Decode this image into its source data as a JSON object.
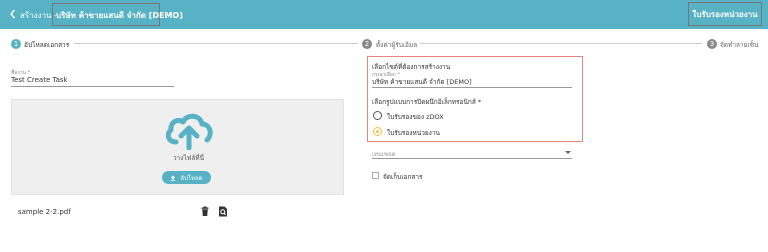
{
  "header": {
    "title": "สร้างงาน - ",
    "company": "บริษัท ค้าขายแสนดี จำกัด [DEMO]",
    "action_label": "ใบรับรองหน่วยงาน",
    "background": "#56b2c4"
  },
  "stepper": {
    "steps": [
      {
        "number": "1",
        "label": "อัปโหลดเอกสาร"
      },
      {
        "number": "2",
        "label": "ตั้งค่าผู้รับเอิมล"
      },
      {
        "number": "3",
        "label": "จัดทำลายเซ็น"
      }
    ]
  },
  "task": {
    "label": "ชื่องาน *",
    "value": "Test Create Task"
  },
  "upload": {
    "drop_text": "วางไฟล์ที่นี่",
    "button_label": "อัปโหลด"
  },
  "file": {
    "name": "sample 2-2.pdf"
  },
  "document_settings": {
    "company_section_title": "เลือกไซต์ที่ต้องการสร้างงาน",
    "company_field_label": "กรุณาเลือก *",
    "company_field_value": "บริษัท ค้าขายแสนดี จำกัด [DEMO]",
    "signature_type_title": "เลือกรูปแบบการปิดผนึกอิเล็กทรอนิกส์ *",
    "options": [
      {
        "label": "ใบรับรองของ zDOX",
        "selected": false
      },
      {
        "label": "ใบรับรองหน่วยงาน",
        "selected": true
      }
    ]
  },
  "template_select": {
    "placeholder": "เทมเพลต"
  },
  "store_document": {
    "label": "จัดเก็บเอกสาร",
    "checked": false
  },
  "colors": {
    "accent": "#56b2c4",
    "radio_selected": "#f0c040",
    "highlight_border": "#e4877d"
  }
}
